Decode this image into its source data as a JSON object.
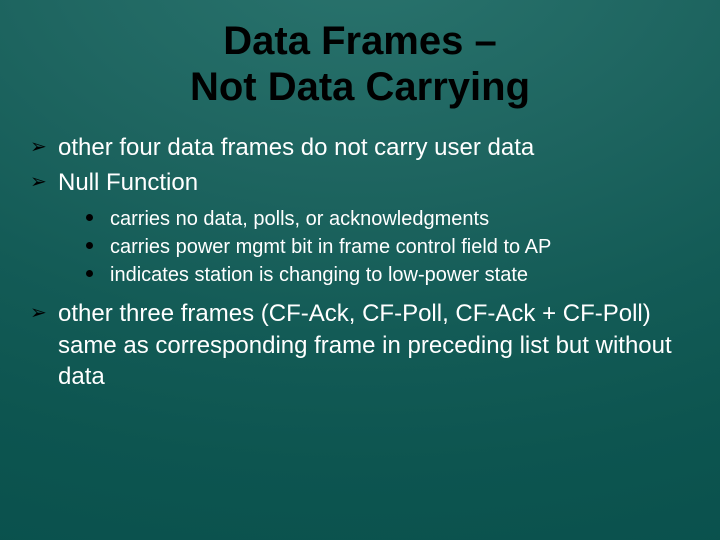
{
  "title": "Data Frames –\nNot Data Carrying",
  "bullets": {
    "b1": "other four data frames do not carry user data",
    "b2": "Null Function",
    "b2sub": {
      "s1": "carries no data, polls, or acknowledgments",
      "s2": "carries power mgmt bit in frame control field to AP",
      "s3": "indicates station is changing to low-power state"
    },
    "b3": "other three frames (CF-Ack, CF-Poll, CF-Ack + CF-Poll) same as corresponding frame in preceding list but without data"
  }
}
